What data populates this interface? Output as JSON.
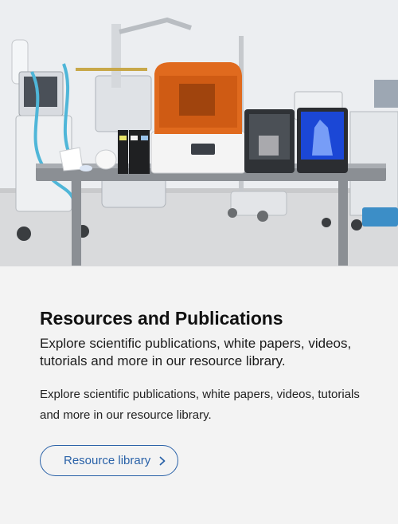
{
  "hero": {
    "image_label": "Lab equipment with 3D printers"
  },
  "section": {
    "title": "Resources and Publications",
    "lead": "Explore scientific publications, white papers, videos, tutorials and more in our resource library.",
    "body": "Explore scientific publications, white papers, videos, tutorials and more in our resource library."
  },
  "cta": {
    "label": "Resource library",
    "icon": "chevron-right-icon"
  },
  "colors": {
    "background": "#f3f3f3",
    "accent": "#2a62a8"
  }
}
